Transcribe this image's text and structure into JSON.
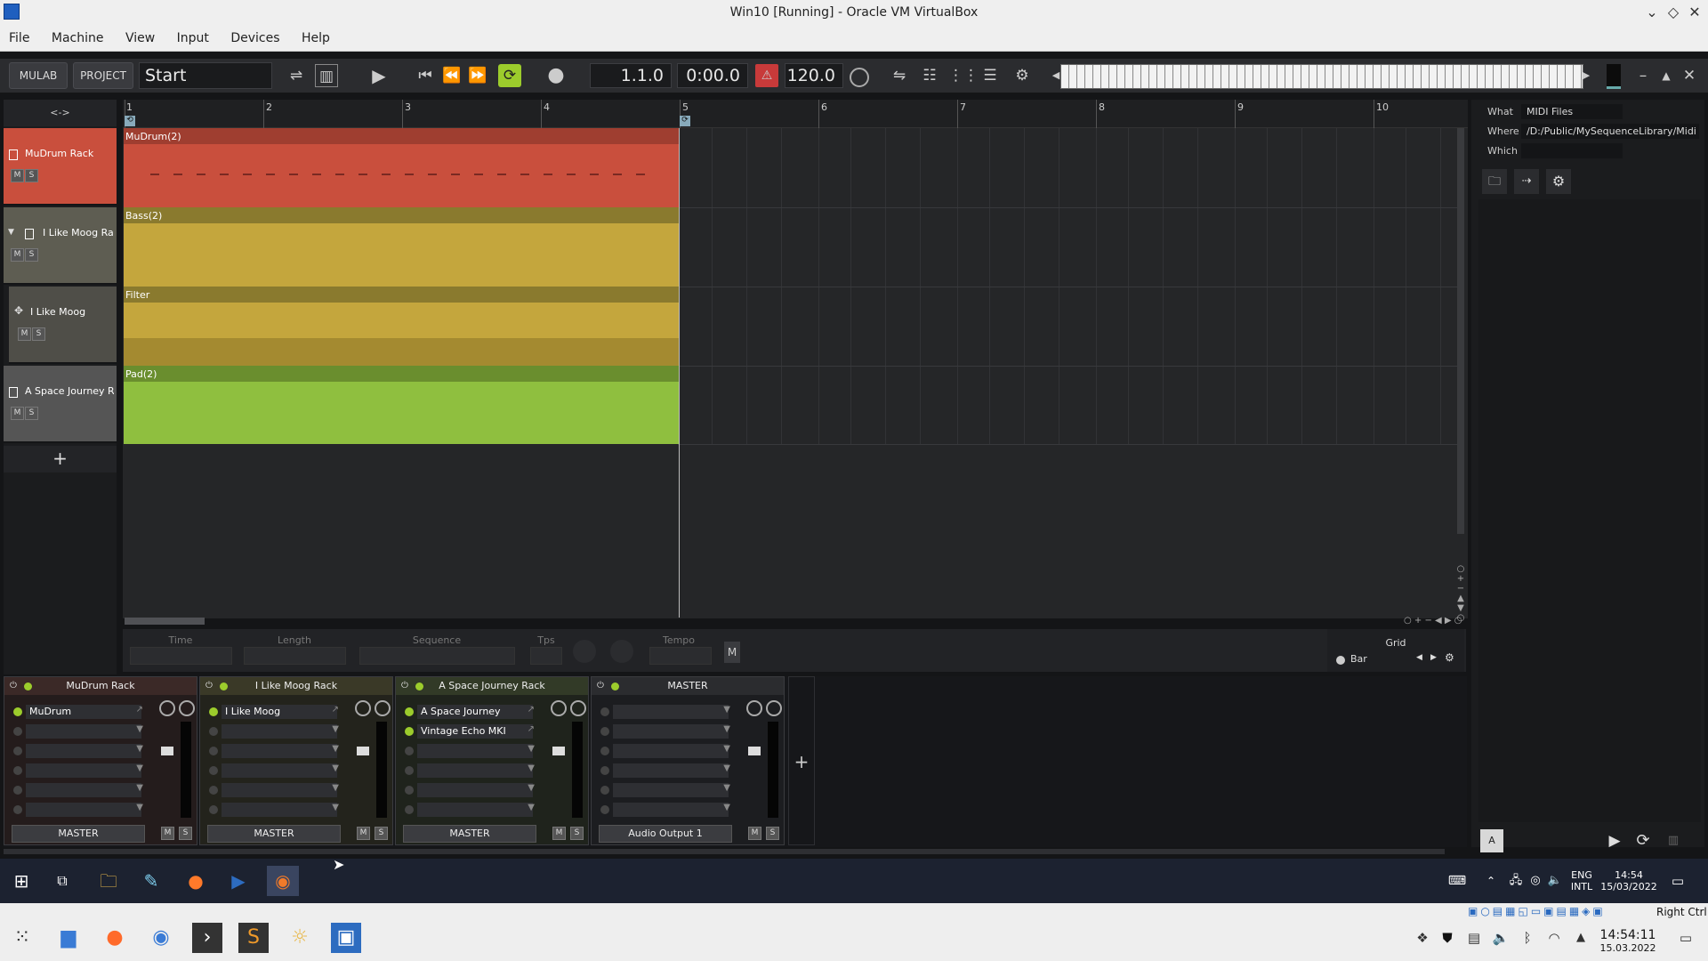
{
  "window": {
    "title": "Win10 [Running] - Oracle VM VirtualBox",
    "menu": [
      "File",
      "Machine",
      "View",
      "Input",
      "Devices",
      "Help"
    ]
  },
  "toolbar": {
    "mulab_label": "MULAB",
    "project_label": "PROJECT",
    "project_name": "Start",
    "position_bar": "1.1.0",
    "position_time": "0:00.0",
    "tempo": "120.0",
    "colors": {
      "loop_active": "#9ccc2c",
      "metronome": "#c83a3a"
    }
  },
  "tracks": [
    {
      "name": "MuDrum Rack",
      "color": "#c94f3d"
    },
    {
      "name": "I Like Moog Ra",
      "color": "#5e5d52"
    },
    {
      "name": "I Like Moog",
      "color": "#4f4e48"
    },
    {
      "name": "A Space Journey R",
      "color": "#555"
    }
  ],
  "track_mute_label": "M",
  "track_solo_label": "S",
  "add_track_symbol": "+",
  "nav_arrows": "<->",
  "ruler": [
    "1",
    "2",
    "3",
    "4",
    "5",
    "6",
    "7",
    "8",
    "9",
    "10"
  ],
  "clips": [
    {
      "name": "MuDrum(2)",
      "header_color": "#9f3e30",
      "body_color": "#c94f3d"
    },
    {
      "name": "Bass(2)",
      "header_color": "#8a7a2e",
      "body_color": "#c4a63d"
    },
    {
      "name": "Filter",
      "header_color": "#8a7a2e",
      "body_color": "#c4a63d"
    },
    {
      "name": "Pad(2)",
      "header_color": "#6a8e2e",
      "body_color": "#8fbf3f"
    }
  ],
  "bottom_panel": {
    "time_label": "Time",
    "length_label": "Length",
    "sequence_label": "Sequence",
    "tps_label": "Tps",
    "tempo_label": "Tempo",
    "m_label": "M",
    "grid_label": "Grid",
    "grid_value": "Bar"
  },
  "mixer": {
    "strips": [
      {
        "name": "MuDrum Rack",
        "slots": [
          "MuDrum"
        ],
        "output": "MASTER",
        "color": "#3b2927"
      },
      {
        "name": "I Like Moog Rack",
        "slots": [
          "I Like Moog"
        ],
        "output": "MASTER",
        "color": "#3a3927"
      },
      {
        "name": "A Space Journey Rack",
        "slots": [
          "A Space Journey",
          "Vintage Echo MKI"
        ],
        "output": "MASTER",
        "color": "#323a27"
      },
      {
        "name": "MASTER",
        "slots": [],
        "output": "Audio Output 1",
        "color": "#2b2c2f"
      }
    ],
    "add_symbol": "+"
  },
  "browser": {
    "what_label": "What",
    "what_value": "MIDI Files",
    "where_label": "Where",
    "where_value": "/D:/Public/MySequenceLibrary/Midi",
    "which_label": "Which",
    "a_label": "A"
  },
  "guest_tray": {
    "lang1": "ENG",
    "lang2": "INTL",
    "time": "14:54",
    "date": "15/03/2022"
  },
  "host_tray": {
    "right_ctrl": "Right Ctrl",
    "time": "14:54:11",
    "date": "15.03.2022"
  }
}
